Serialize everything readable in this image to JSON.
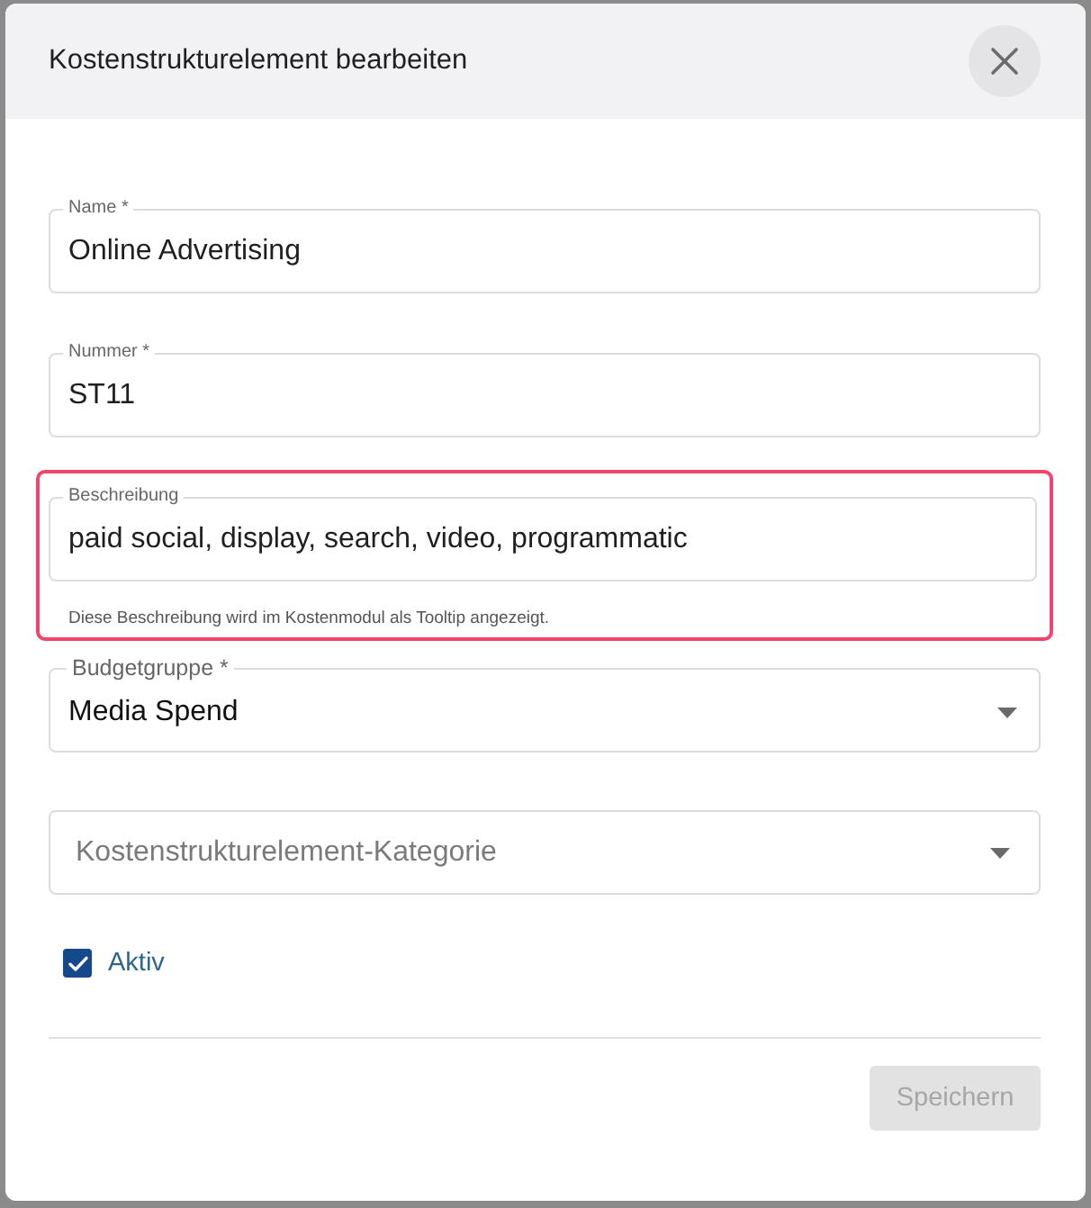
{
  "dialog": {
    "title": "Kostenstrukturelement bearbeiten"
  },
  "fields": [
    {
      "kind": "text",
      "label": "Name *",
      "value": "Online Advertising",
      "highlighted": false
    },
    {
      "kind": "text",
      "label": "Nummer *",
      "value": "ST11",
      "highlighted": false
    },
    {
      "kind": "text",
      "label": "Beschreibung",
      "value": "paid social, display, search, video, programmatic",
      "helper": "Diese Beschreibung wird im Kostenmodul als Tooltip angezeigt.",
      "highlighted": true
    },
    {
      "kind": "select",
      "label": "Budgetgruppe *",
      "value": "Media Spend",
      "highlighted": false
    },
    {
      "kind": "select",
      "placeholder": "Kostenstrukturelement-Kategorie",
      "highlighted": false
    }
  ],
  "checkbox": {
    "label": "Aktiv",
    "checked": true
  },
  "save_button": {
    "label": "Speichern",
    "disabled": true
  }
}
